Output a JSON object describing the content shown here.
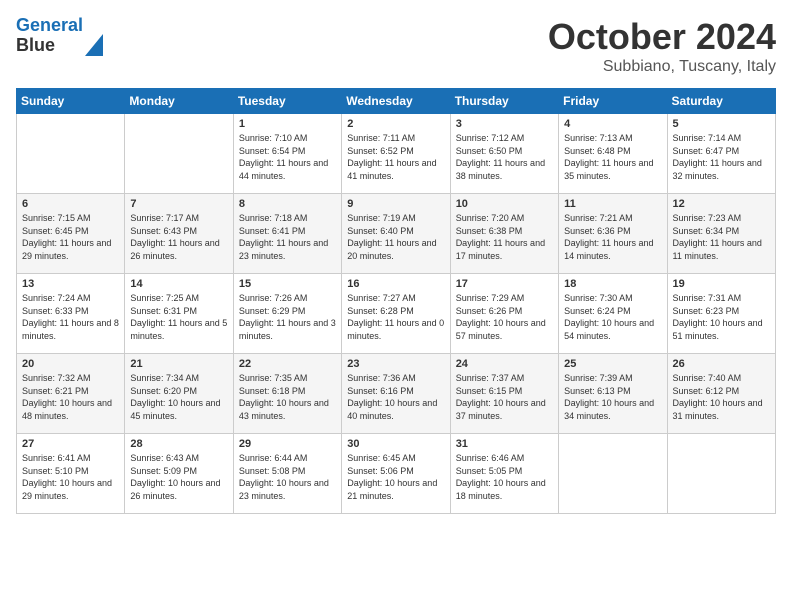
{
  "header": {
    "logo_line1": "General",
    "logo_line2": "Blue",
    "month": "October 2024",
    "location": "Subbiano, Tuscany, Italy"
  },
  "days_of_week": [
    "Sunday",
    "Monday",
    "Tuesday",
    "Wednesday",
    "Thursday",
    "Friday",
    "Saturday"
  ],
  "weeks": [
    [
      {
        "day": "",
        "info": ""
      },
      {
        "day": "",
        "info": ""
      },
      {
        "day": "1",
        "info": "Sunrise: 7:10 AM\nSunset: 6:54 PM\nDaylight: 11 hours and 44 minutes."
      },
      {
        "day": "2",
        "info": "Sunrise: 7:11 AM\nSunset: 6:52 PM\nDaylight: 11 hours and 41 minutes."
      },
      {
        "day": "3",
        "info": "Sunrise: 7:12 AM\nSunset: 6:50 PM\nDaylight: 11 hours and 38 minutes."
      },
      {
        "day": "4",
        "info": "Sunrise: 7:13 AM\nSunset: 6:48 PM\nDaylight: 11 hours and 35 minutes."
      },
      {
        "day": "5",
        "info": "Sunrise: 7:14 AM\nSunset: 6:47 PM\nDaylight: 11 hours and 32 minutes."
      }
    ],
    [
      {
        "day": "6",
        "info": "Sunrise: 7:15 AM\nSunset: 6:45 PM\nDaylight: 11 hours and 29 minutes."
      },
      {
        "day": "7",
        "info": "Sunrise: 7:17 AM\nSunset: 6:43 PM\nDaylight: 11 hours and 26 minutes."
      },
      {
        "day": "8",
        "info": "Sunrise: 7:18 AM\nSunset: 6:41 PM\nDaylight: 11 hours and 23 minutes."
      },
      {
        "day": "9",
        "info": "Sunrise: 7:19 AM\nSunset: 6:40 PM\nDaylight: 11 hours and 20 minutes."
      },
      {
        "day": "10",
        "info": "Sunrise: 7:20 AM\nSunset: 6:38 PM\nDaylight: 11 hours and 17 minutes."
      },
      {
        "day": "11",
        "info": "Sunrise: 7:21 AM\nSunset: 6:36 PM\nDaylight: 11 hours and 14 minutes."
      },
      {
        "day": "12",
        "info": "Sunrise: 7:23 AM\nSunset: 6:34 PM\nDaylight: 11 hours and 11 minutes."
      }
    ],
    [
      {
        "day": "13",
        "info": "Sunrise: 7:24 AM\nSunset: 6:33 PM\nDaylight: 11 hours and 8 minutes."
      },
      {
        "day": "14",
        "info": "Sunrise: 7:25 AM\nSunset: 6:31 PM\nDaylight: 11 hours and 5 minutes."
      },
      {
        "day": "15",
        "info": "Sunrise: 7:26 AM\nSunset: 6:29 PM\nDaylight: 11 hours and 3 minutes."
      },
      {
        "day": "16",
        "info": "Sunrise: 7:27 AM\nSunset: 6:28 PM\nDaylight: 11 hours and 0 minutes."
      },
      {
        "day": "17",
        "info": "Sunrise: 7:29 AM\nSunset: 6:26 PM\nDaylight: 10 hours and 57 minutes."
      },
      {
        "day": "18",
        "info": "Sunrise: 7:30 AM\nSunset: 6:24 PM\nDaylight: 10 hours and 54 minutes."
      },
      {
        "day": "19",
        "info": "Sunrise: 7:31 AM\nSunset: 6:23 PM\nDaylight: 10 hours and 51 minutes."
      }
    ],
    [
      {
        "day": "20",
        "info": "Sunrise: 7:32 AM\nSunset: 6:21 PM\nDaylight: 10 hours and 48 minutes."
      },
      {
        "day": "21",
        "info": "Sunrise: 7:34 AM\nSunset: 6:20 PM\nDaylight: 10 hours and 45 minutes."
      },
      {
        "day": "22",
        "info": "Sunrise: 7:35 AM\nSunset: 6:18 PM\nDaylight: 10 hours and 43 minutes."
      },
      {
        "day": "23",
        "info": "Sunrise: 7:36 AM\nSunset: 6:16 PM\nDaylight: 10 hours and 40 minutes."
      },
      {
        "day": "24",
        "info": "Sunrise: 7:37 AM\nSunset: 6:15 PM\nDaylight: 10 hours and 37 minutes."
      },
      {
        "day": "25",
        "info": "Sunrise: 7:39 AM\nSunset: 6:13 PM\nDaylight: 10 hours and 34 minutes."
      },
      {
        "day": "26",
        "info": "Sunrise: 7:40 AM\nSunset: 6:12 PM\nDaylight: 10 hours and 31 minutes."
      }
    ],
    [
      {
        "day": "27",
        "info": "Sunrise: 6:41 AM\nSunset: 5:10 PM\nDaylight: 10 hours and 29 minutes."
      },
      {
        "day": "28",
        "info": "Sunrise: 6:43 AM\nSunset: 5:09 PM\nDaylight: 10 hours and 26 minutes."
      },
      {
        "day": "29",
        "info": "Sunrise: 6:44 AM\nSunset: 5:08 PM\nDaylight: 10 hours and 23 minutes."
      },
      {
        "day": "30",
        "info": "Sunrise: 6:45 AM\nSunset: 5:06 PM\nDaylight: 10 hours and 21 minutes."
      },
      {
        "day": "31",
        "info": "Sunrise: 6:46 AM\nSunset: 5:05 PM\nDaylight: 10 hours and 18 minutes."
      },
      {
        "day": "",
        "info": ""
      },
      {
        "day": "",
        "info": ""
      }
    ]
  ]
}
